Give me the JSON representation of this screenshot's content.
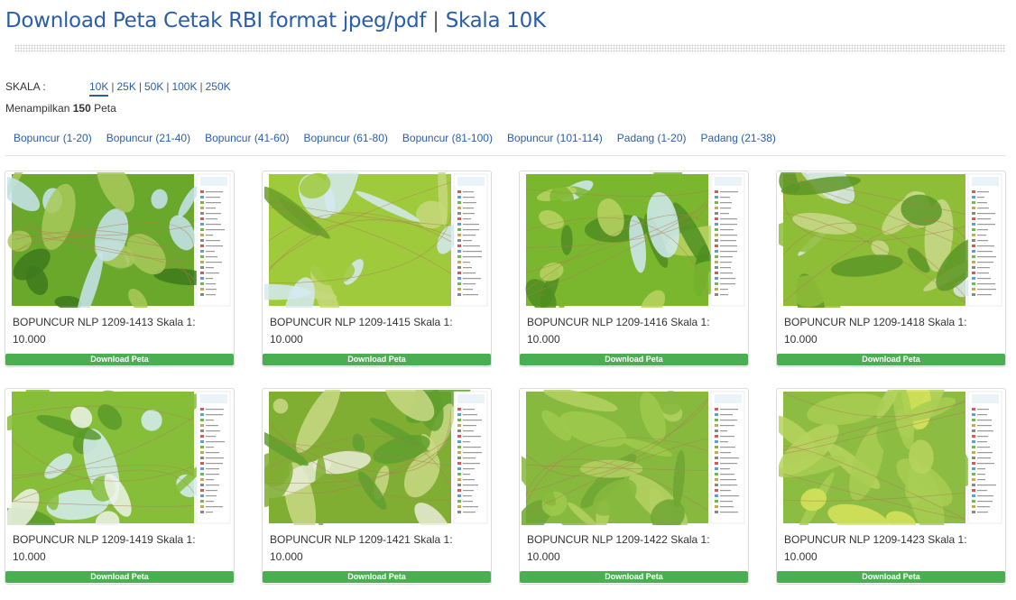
{
  "heading": {
    "main": "Download Peta Cetak RBI format jpeg/pdf",
    "separator": "|",
    "scale": "Skala 10K"
  },
  "filter": {
    "label": "SKALA :",
    "options": [
      "10K",
      "25K",
      "50K",
      "100K",
      "250K"
    ],
    "active": "10K"
  },
  "count": {
    "prefix": "Menampilkan",
    "number": "150",
    "suffix": "Peta"
  },
  "page_links": [
    "Bopuncur (1-20)",
    "Bopuncur (21-40)",
    "Bopuncur (41-60)",
    "Bopuncur (61-80)",
    "Bopuncur (81-100)",
    "Bopuncur (101-114)",
    "Padang (1-20)",
    "Padang (21-38)"
  ],
  "maps": [
    {
      "title": "BOPUNCUR NLP 1209-1413 Skala 1: 10.000",
      "button": "Download Peta",
      "palette": [
        "#c7e4ee",
        "#6aa82b",
        "#3d7a1c",
        "#a9c95a"
      ]
    },
    {
      "title": "BOPUNCUR NLP 1209-1415 Skala 1: 10.000",
      "button": "Download Peta",
      "palette": [
        "#d3eaf1",
        "#9fca3c",
        "#6a9f28",
        "#c6d87b"
      ]
    },
    {
      "title": "BOPUNCUR NLP 1209-1416 Skala 1: 10.000",
      "button": "Download Peta",
      "palette": [
        "#d2eaf3",
        "#7ab72e",
        "#4f8e22",
        "#b8d462"
      ]
    },
    {
      "title": "BOPUNCUR NLP 1209-1418 Skala 1: 10.000",
      "button": "Download Peta",
      "palette": [
        "#dbe9ec",
        "#8ebd38",
        "#5c9727",
        "#c9d989"
      ]
    },
    {
      "title": "BOPUNCUR NLP 1209-1419 Skala 1: 10.000",
      "button": "Download Peta",
      "palette": [
        "#d6edf3",
        "#86bd39",
        "#5a9a2a",
        "#eef3ea"
      ]
    },
    {
      "title": "BOPUNCUR NLP 1209-1421 Skala 1: 10.000",
      "button": "Download Peta",
      "palette": [
        "#e9ecd8",
        "#7fae33",
        "#5f9f2e",
        "#c9d985"
      ]
    },
    {
      "title": "BOPUNCUR NLP 1209-1422 Skala 1: 10.000",
      "button": "Download Peta",
      "palette": [
        "#9fca4c",
        "#86b93d",
        "#6ea634",
        "#b4d062"
      ]
    },
    {
      "title": "BOPUNCUR NLP 1209-1423 Skala 1: 10.000",
      "button": "Download Peta",
      "palette": [
        "#a8ce52",
        "#8cbc42",
        "#d7e35a",
        "#b6d35e"
      ]
    }
  ]
}
